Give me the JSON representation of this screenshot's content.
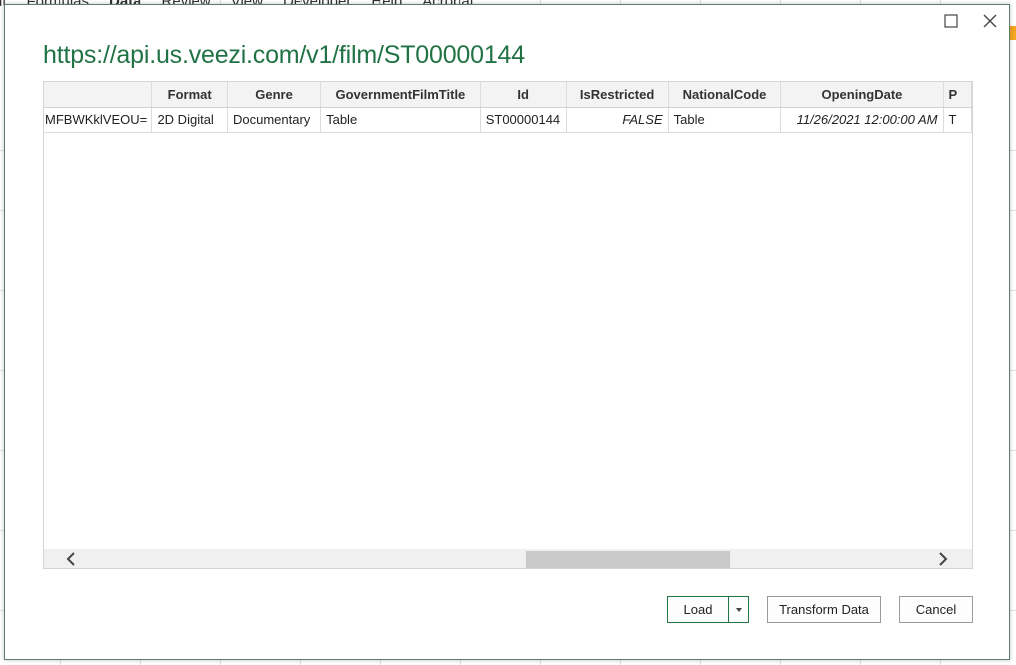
{
  "background": {
    "ribbon_tabs": [
      "ut",
      "Formulas",
      "Data",
      "Review",
      "View",
      "Developer",
      "Help",
      "Acrobat"
    ],
    "active_tab": "Data"
  },
  "dialog": {
    "title": "https://api.us.veezi.com/v1/film/ST00000144",
    "maximize_icon": "maximize-icon",
    "close_icon": "close-icon"
  },
  "table": {
    "columns": [
      {
        "label": ""
      },
      {
        "label": "Format"
      },
      {
        "label": "Genre"
      },
      {
        "label": "GovernmentFilmTitle"
      },
      {
        "label": "Id"
      },
      {
        "label": "IsRestricted"
      },
      {
        "label": "NationalCode"
      },
      {
        "label": "OpeningDate"
      },
      {
        "label": "P"
      }
    ],
    "rows": [
      [
        "=MFBWKklVEOU",
        "2D Digital",
        "Documentary",
        "Table",
        "ST00000144",
        "FALSE",
        "Table",
        "11/26/2021 12:00:00 AM",
        "T"
      ]
    ]
  },
  "scrollbar": {
    "left_icon": "chevron-left-icon",
    "right_icon": "chevron-right-icon"
  },
  "buttons": {
    "load": "Load",
    "transform": "Transform Data",
    "cancel": "Cancel"
  }
}
